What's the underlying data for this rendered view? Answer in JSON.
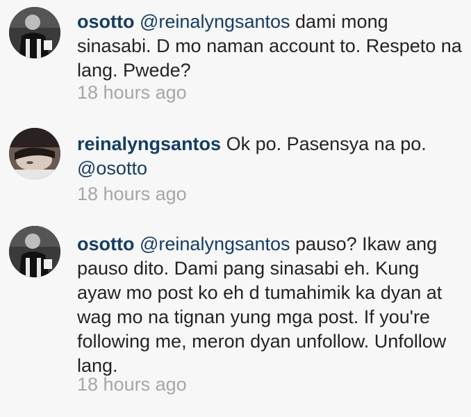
{
  "comments": [
    {
      "username": "osotto",
      "mention": "@reinalyngsantos",
      "text_before": "",
      "text_after": " dami mong sinasabi. D mo naman account to. Respeto na lang. Pwede?",
      "time": "18 hours ago",
      "avatar_icon": "profile-photo-osotto"
    },
    {
      "username": "reinalyngsantos",
      "mention": "@osotto",
      "text_before": " Ok po. Pasensya na po. ",
      "text_after": "",
      "time": "18 hours ago",
      "avatar_icon": "profile-photo-reinalyngsantos"
    },
    {
      "username": "osotto",
      "mention": "@reinalyngsantos",
      "text_before": "",
      "text_after": " pauso? Ikaw ang pauso dito. Dami pang sinasabi eh. Kung ayaw mo post ko eh d tumahimik ka dyan at wag mo na tignan yung mga post. If you're following me, meron dyan unfollow. Unfollow lang.",
      "time": "18 hours ago",
      "avatar_icon": "profile-photo-osotto"
    }
  ],
  "colors": {
    "username": "#153d63",
    "body_text": "#232323",
    "timestamp": "#a6a6a6",
    "background": "#f7f7f7"
  }
}
